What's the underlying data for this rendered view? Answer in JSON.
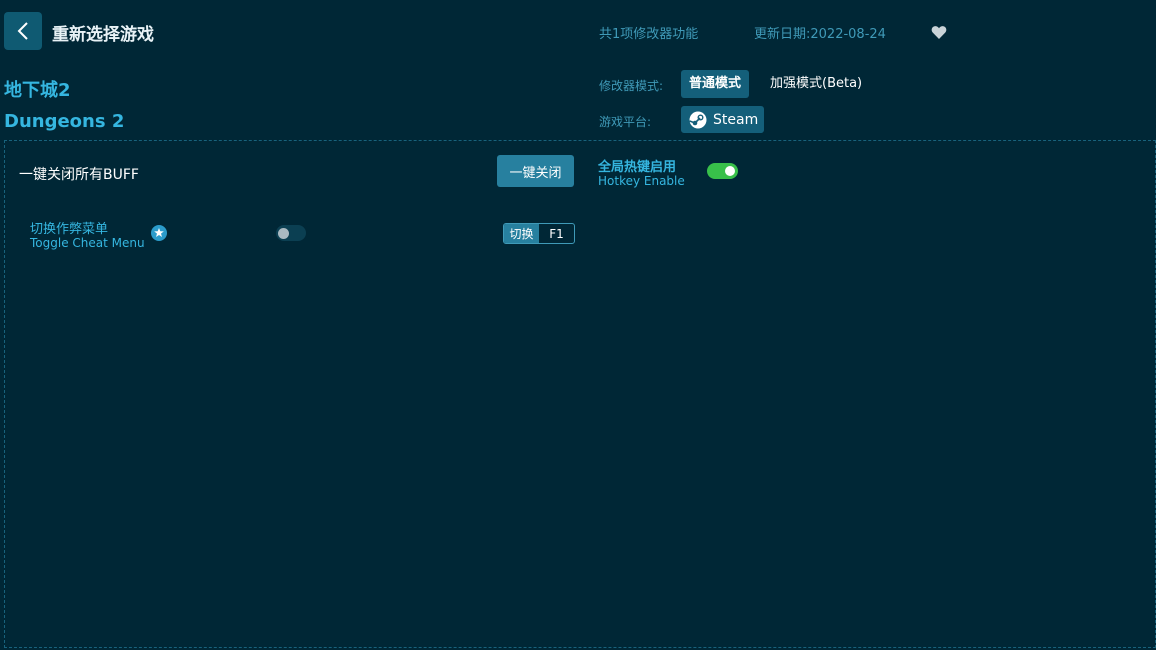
{
  "header": {
    "title": "重新选择游戏",
    "feature_count": "共1项修改器功能",
    "update_date": "更新日期:2022-08-24"
  },
  "game": {
    "name_cn": "地下城2",
    "name_en": "Dungeons 2"
  },
  "modes": {
    "label": "修改器模式:",
    "normal": "普通模式",
    "enhanced": "加强模式(Beta)",
    "active": "普通模式"
  },
  "platform": {
    "label": "游戏平台:",
    "name": "Steam"
  },
  "panel": {
    "close_all_label": "一键关闭所有BUFF",
    "close_all_button": "一键关闭",
    "hotkey_enable_cn": "全局热键启用",
    "hotkey_enable_en": "Hotkey Enable",
    "hotkey_enabled": true,
    "cheats": [
      {
        "name_cn": "切换作弊菜单",
        "name_en": "Toggle Cheat Menu",
        "enabled": false,
        "action": "切换",
        "key": "F1"
      }
    ]
  },
  "colors": {
    "background": "#002736",
    "accent": "#35b6e0",
    "button": "#27809f",
    "toggle_on": "#38c04a"
  },
  "icons": [
    "chevron-left-icon",
    "heart-icon",
    "steam-icon",
    "star-icon"
  ]
}
